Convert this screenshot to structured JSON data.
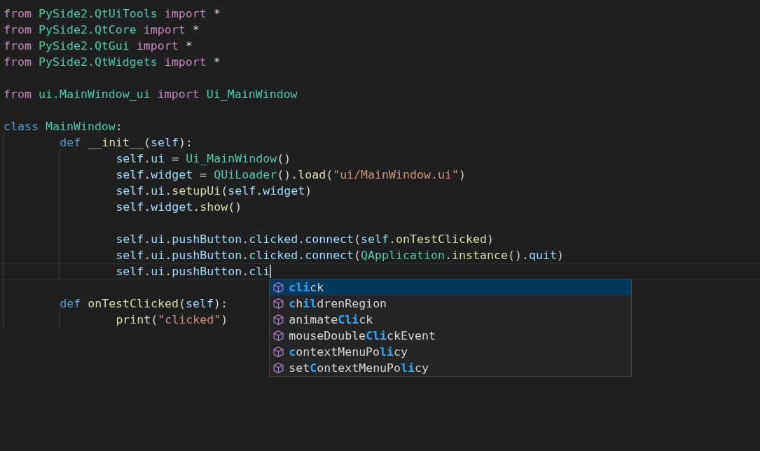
{
  "editor": {
    "lines": [
      {
        "current": false,
        "tokens": [
          {
            "text": "from",
            "kind": "import"
          },
          {
            "text": " PySide2.QtUiTools",
            "kind": "module"
          },
          {
            "text": " import",
            "kind": "import"
          },
          {
            "text": " *"
          }
        ]
      },
      {
        "current": false,
        "tokens": [
          {
            "text": "from",
            "kind": "import"
          },
          {
            "text": " PySide2.QtCore",
            "kind": "module"
          },
          {
            "text": " import",
            "kind": "import"
          },
          {
            "text": " *"
          }
        ]
      },
      {
        "current": false,
        "tokens": [
          {
            "text": "from",
            "kind": "import"
          },
          {
            "text": " PySide2.QtGui",
            "kind": "module"
          },
          {
            "text": " import",
            "kind": "import"
          },
          {
            "text": " *"
          }
        ]
      },
      {
        "current": false,
        "tokens": [
          {
            "text": "from",
            "kind": "import"
          },
          {
            "text": " PySide2.QtWidgets",
            "kind": "module"
          },
          {
            "text": " import",
            "kind": "import"
          },
          {
            "text": " *"
          }
        ]
      },
      {
        "kind": "blank"
      },
      {
        "current": false,
        "tokens": [
          {
            "text": "from",
            "kind": "import"
          },
          {
            "text": " ui.MainWindow_ui",
            "kind": "module"
          },
          {
            "text": " import",
            "kind": "import"
          },
          {
            "text": " Ui_MainWindow",
            "kind": "class"
          }
        ]
      },
      {
        "kind": "blank"
      },
      {
        "current": false,
        "tokens": [
          {
            "text": "class",
            "kind": "keyword"
          },
          {
            "text": " MainWindow",
            "kind": "class"
          },
          {
            "text": ":"
          }
        ],
        "children": [
          {
            "current": false,
            "tokens": [
              {
                "text": "def",
                "kind": "keyword"
              },
              {
                "text": " __init__",
                "kind": "function"
              },
              {
                "text": "("
              },
              {
                "text": "self",
                "kind": "variable"
              },
              {
                "text": "):"
              }
            ],
            "children": [
              {
                "current": false,
                "tokens": [
                  {
                    "text": "self",
                    "kind": "variable"
                  },
                  {
                    "text": "."
                  },
                  {
                    "text": "ui",
                    "kind": "variable"
                  },
                  {
                    "text": " ="
                  },
                  {
                    "text": " Ui_MainWindow",
                    "kind": "class"
                  },
                  {
                    "text": "()"
                  }
                ]
              },
              {
                "current": false,
                "tokens": [
                  {
                    "text": "self",
                    "kind": "variable"
                  },
                  {
                    "text": "."
                  },
                  {
                    "text": "widget",
                    "kind": "variable"
                  },
                  {
                    "text": " ="
                  },
                  {
                    "text": " QUiLoader",
                    "kind": "class"
                  },
                  {
                    "text": "()."
                  },
                  {
                    "text": "load",
                    "kind": "function"
                  },
                  {
                    "text": "("
                  },
                  {
                    "text": "\"ui/MainWindow.ui\"",
                    "kind": "string"
                  },
                  {
                    "text": ")"
                  }
                ]
              },
              {
                "current": false,
                "tokens": [
                  {
                    "text": "self",
                    "kind": "variable"
                  },
                  {
                    "text": "."
                  },
                  {
                    "text": "ui",
                    "kind": "variable"
                  },
                  {
                    "text": "."
                  },
                  {
                    "text": "setupUi",
                    "kind": "function"
                  },
                  {
                    "text": "("
                  },
                  {
                    "text": "self",
                    "kind": "variable"
                  },
                  {
                    "text": "."
                  },
                  {
                    "text": "widget",
                    "kind": "variable"
                  },
                  {
                    "text": ")"
                  }
                ]
              },
              {
                "current": false,
                "tokens": [
                  {
                    "text": "self",
                    "kind": "variable"
                  },
                  {
                    "text": "."
                  },
                  {
                    "text": "widget",
                    "kind": "variable"
                  },
                  {
                    "text": "."
                  },
                  {
                    "text": "show",
                    "kind": "function"
                  },
                  {
                    "text": "()"
                  }
                ]
              },
              {
                "kind": "blank"
              },
              {
                "current": false,
                "tokens": [
                  {
                    "text": "self",
                    "kind": "variable"
                  },
                  {
                    "text": "."
                  },
                  {
                    "text": "ui",
                    "kind": "variable"
                  },
                  {
                    "text": "."
                  },
                  {
                    "text": "pushButton",
                    "kind": "variable"
                  },
                  {
                    "text": "."
                  },
                  {
                    "text": "clicked",
                    "kind": "variable"
                  },
                  {
                    "text": "."
                  },
                  {
                    "text": "connect",
                    "kind": "variable"
                  },
                  {
                    "text": "("
                  },
                  {
                    "text": "self",
                    "kind": "variable"
                  },
                  {
                    "text": "."
                  },
                  {
                    "text": "onTestClicked",
                    "kind": "function"
                  },
                  {
                    "text": ")"
                  }
                ]
              },
              {
                "current": false,
                "tokens": [
                  {
                    "text": "self",
                    "kind": "variable"
                  },
                  {
                    "text": "."
                  },
                  {
                    "text": "ui",
                    "kind": "variable"
                  },
                  {
                    "text": "."
                  },
                  {
                    "text": "pushButton",
                    "kind": "variable"
                  },
                  {
                    "text": "."
                  },
                  {
                    "text": "clicked",
                    "kind": "variable"
                  },
                  {
                    "text": "."
                  },
                  {
                    "text": "connect",
                    "kind": "variable"
                  },
                  {
                    "text": "("
                  },
                  {
                    "text": "QApplication",
                    "kind": "class"
                  },
                  {
                    "text": "."
                  },
                  {
                    "text": "instance",
                    "kind": "function"
                  },
                  {
                    "text": "()."
                  },
                  {
                    "text": "quit",
                    "kind": "variable"
                  },
                  {
                    "text": ")"
                  }
                ]
              },
              {
                "current": true,
                "tokens": [
                  {
                    "text": "self",
                    "kind": "variable"
                  },
                  {
                    "text": "."
                  },
                  {
                    "text": "ui",
                    "kind": "variable"
                  },
                  {
                    "text": "."
                  },
                  {
                    "text": "pushButton",
                    "kind": "variable"
                  },
                  {
                    "text": "."
                  },
                  {
                    "text": "cli",
                    "kind": "variable"
                  }
                ]
              }
            ]
          },
          {
            "kind": "blank"
          },
          {
            "current": false,
            "tokens": [
              {
                "text": "def",
                "kind": "keyword"
              },
              {
                "text": " onTestClicked",
                "kind": "function"
              },
              {
                "text": "("
              },
              {
                "text": "self",
                "kind": "variable"
              },
              {
                "text": "):"
              }
            ],
            "children": [
              {
                "current": false,
                "tokens": [
                  {
                    "text": "print",
                    "kind": "function"
                  },
                  {
                    "text": "("
                  },
                  {
                    "text": "\"clicked\"",
                    "kind": "string"
                  },
                  {
                    "text": ")"
                  }
                ]
              }
            ]
          }
        ]
      }
    ]
  },
  "suggestions": [
    {
      "label": "**cli**ck",
      "selected": true
    },
    {
      "label": "**c**h**il**drenRegion",
      "selected": false
    },
    {
      "label": "animate**Cli**ck",
      "selected": false
    },
    {
      "label": "mouseDouble**Cli**ckEvent",
      "selected": false
    },
    {
      "label": "**c**ontextMenuPo**li**cy",
      "selected": false
    },
    {
      "label": "set**C**ontextMenuPo**li**cy",
      "selected": false
    }
  ]
}
